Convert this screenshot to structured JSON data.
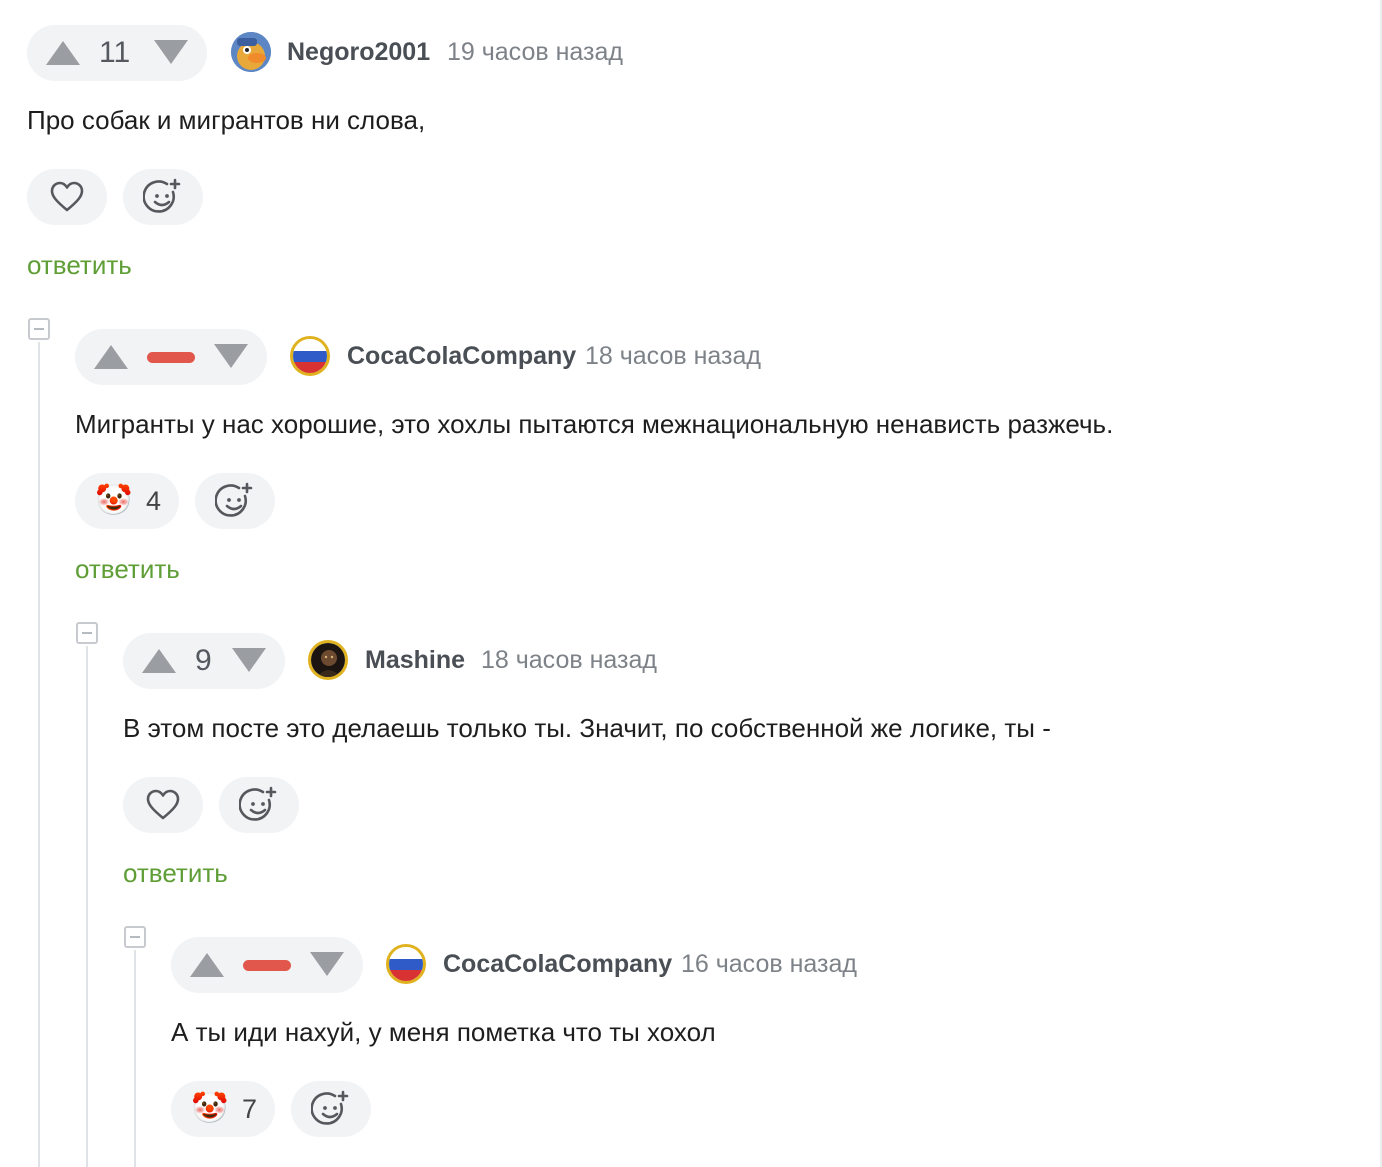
{
  "colors": {
    "accent_green": "#5f9e36",
    "negative_red": "#e2574c",
    "pill_bg": "#f2f3f5",
    "arrow_gray": "#9a9da1"
  },
  "icons": {
    "upvote": "triangle-up-icon",
    "downvote": "triangle-down-icon",
    "like": "heart-icon",
    "add_reaction": "smiley-plus-icon",
    "collapse": "minus-square-icon",
    "reaction_emoji": "clown-face-icon"
  },
  "comments": [
    {
      "rating": "11",
      "username": "Negoro2001",
      "time": "19 часов назад",
      "text": "Про собак и мигрантов ни слова,",
      "reply_label": "ответить"
    },
    {
      "rating": "",
      "rating_state": "negative",
      "username": "CocaColaCompany",
      "time": "18 часов назад",
      "text": "Мигранты у нас хорошие, это хохлы пытаются межнациональную ненависть разжечь.",
      "reaction": {
        "emoji": "🤡",
        "count": "4"
      },
      "reply_label": "ответить"
    },
    {
      "rating": "9",
      "username": "Mashine",
      "time": "18 часов назад",
      "text": "В этом посте это делаешь только ты. Значит, по собственной же логике, ты -",
      "reply_label": "ответить"
    },
    {
      "rating": "",
      "rating_state": "negative",
      "username": "CocaColaCompany",
      "time": "16 часов назад",
      "text": "А ты иди нахуй, у меня пометка что ты хохол",
      "reaction": {
        "emoji": "🤡",
        "count": "7"
      }
    }
  ]
}
